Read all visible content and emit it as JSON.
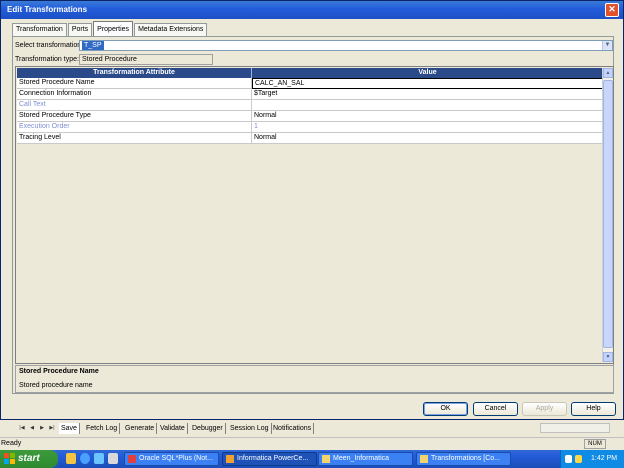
{
  "dialog": {
    "title": "Edit Transformations",
    "close_glyph": "✕",
    "tabs": [
      {
        "label": "Transformation"
      },
      {
        "label": "Ports"
      },
      {
        "label": "Properties"
      },
      {
        "label": "Metadata Extensions"
      }
    ],
    "select_label": "Select transformation:",
    "select_value": "T_SP",
    "select_arrow": "▼",
    "type_label": "Transformation type:",
    "type_value": "Stored Procedure",
    "grid": {
      "headers": [
        "Transformation Attribute",
        "Value"
      ],
      "rows": [
        {
          "attribute": "Stored Procedure Name",
          "value": "CALC_AN_SAL"
        },
        {
          "attribute": "Connection Information",
          "value": "$Target"
        },
        {
          "attribute": "Call Text",
          "value": ""
        },
        {
          "attribute": "Stored Procedure Type",
          "value": "Normal"
        },
        {
          "attribute": "Execution Order",
          "value": "1"
        },
        {
          "attribute": "Tracing Level",
          "value": "Normal"
        }
      ],
      "scroll_up": "▲",
      "scroll_down": "▼"
    },
    "description": {
      "title": "Stored Procedure Name",
      "text": "Stored procedure name"
    },
    "buttons": {
      "ok": "OK",
      "cancel": "Cancel",
      "apply": "Apply",
      "help": "Help"
    }
  },
  "app": {
    "bottom_tabs": [
      "Save",
      "Fetch Log",
      "Generate",
      "Validate",
      "Debugger",
      "Session Log",
      "Notifications"
    ],
    "nav": [
      "|◀",
      "◀",
      "▶",
      "▶|"
    ],
    "status": "Ready",
    "num_indicator": "NUM"
  },
  "taskbar": {
    "start_label": "start",
    "tasks": [
      {
        "label": "Oracle SQL*Plus (Not..."
      },
      {
        "label": "Informatica PowerCe..."
      },
      {
        "label": "Meen_Informatica"
      },
      {
        "label": "Transformations [Co..."
      }
    ],
    "clock": "1:42 PM"
  }
}
